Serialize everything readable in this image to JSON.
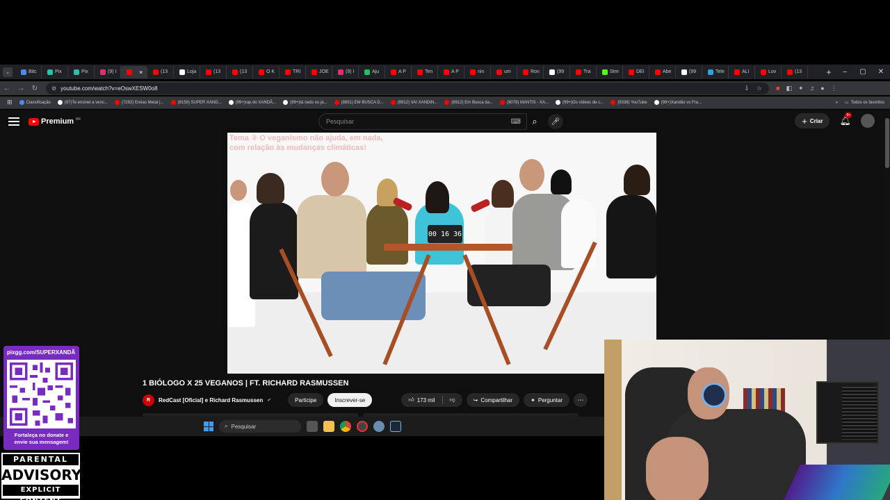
{
  "browser": {
    "tabs": [
      {
        "label": "Bitc",
        "color": "#4c8bf5"
      },
      {
        "label": "Pix",
        "color": "#32bcad"
      },
      {
        "label": "Pix",
        "color": "#32bcad"
      },
      {
        "label": "(9) I",
        "color": "#e1306c"
      },
      {
        "label": "",
        "color": "#ff0000",
        "active": true
      },
      {
        "label": "(13",
        "color": "#ff0000"
      },
      {
        "label": "Loja",
        "color": "#ffffff"
      },
      {
        "label": "(13",
        "color": "#ff0000"
      },
      {
        "label": "(13",
        "color": "#ff0000"
      },
      {
        "label": "O K",
        "color": "#ff0000"
      },
      {
        "label": "TRI",
        "color": "#ff0000"
      },
      {
        "label": "JOE",
        "color": "#ff0000"
      },
      {
        "label": "(9) I",
        "color": "#e1306c"
      },
      {
        "label": "Aju",
        "color": "#20c05c"
      },
      {
        "label": "A P",
        "color": "#ff0000"
      },
      {
        "label": "Ten",
        "color": "#ff0000"
      },
      {
        "label": "A P",
        "color": "#ff0000"
      },
      {
        "label": "nin",
        "color": "#ff0000"
      },
      {
        "label": "um",
        "color": "#ff0000"
      },
      {
        "label": "Ron",
        "color": "#ff0000"
      },
      {
        "label": "(99",
        "color": "#ffffff"
      },
      {
        "label": "Tra",
        "color": "#ff0000"
      },
      {
        "label": "Stre",
        "color": "#53fc18"
      },
      {
        "label": "DEI",
        "color": "#ff0000"
      },
      {
        "label": "Abe",
        "color": "#ff0000"
      },
      {
        "label": "(99",
        "color": "#ffffff"
      },
      {
        "label": "Tele",
        "color": "#2aa3e0"
      },
      {
        "label": "ALI",
        "color": "#ff0000"
      },
      {
        "label": "Lov",
        "color": "#ff0000"
      },
      {
        "label": "(13",
        "color": "#ff0000"
      }
    ],
    "tab_close": "×",
    "new_tab": "+",
    "window_controls": {
      "minimize": "–",
      "maximize": "▢",
      "close": "✕"
    },
    "url": "youtube.com/watch?v=eOswXESW0o8",
    "bookmarks": [
      {
        "label": "Classificação",
        "color": "#4c8bf5"
      },
      {
        "label": "(97)Te ensinei a venc...",
        "color": "#ffffff"
      },
      {
        "label": "(7292) Enéas Metal |...",
        "color": "#ff0000"
      },
      {
        "label": "(8159) SUPER XAND...",
        "color": "#ff0000"
      },
      {
        "label": "(99+)rap do XANDÃ...",
        "color": "#ffffff"
      },
      {
        "label": "(99+)tá cedo ou já...",
        "color": "#ffffff"
      },
      {
        "label": "(8851) EM BUSCA D...",
        "color": "#ff0000"
      },
      {
        "label": "(8912) VAI XANDIN...",
        "color": "#ff0000"
      },
      {
        "label": "(8912) Em Busca da...",
        "color": "#ff0000"
      },
      {
        "label": "(9078) MANTIS - XA...",
        "color": "#ff0000"
      },
      {
        "label": "(99+)Os vídeos de c...",
        "color": "#ffffff"
      },
      {
        "label": "(9338) YouTube",
        "color": "#ff0000"
      },
      {
        "label": "(99+)Xandão vs Fra...",
        "color": "#ffffff"
      }
    ],
    "bookmarks_more": "»",
    "all_bookmarks": "Todos os favoritos"
  },
  "youtube": {
    "logo_text": "Premium",
    "logo_region": "BR",
    "search_placeholder": "Pesquisar",
    "create_label": "Criar",
    "notif_badge": "9+",
    "video": {
      "caption_line1": "Tema ② O veganismo não ajuda, em nada,",
      "caption_line2": "com relação às mudanças climáticas!",
      "timer": "00 16 36"
    },
    "title": "1 BIÓLOGO X 25 VEGANOS | FT. RICHARD RASMUSSEN",
    "channel_initial": "R",
    "channel": "RedCast [Oficial] e Richard Rasmussen",
    "verified": "✔",
    "join_label": "Participe",
    "subscribe_label": "Inscrever-se",
    "likes": "173 mil",
    "share_label": "Compartilhar",
    "ask_label": "Perguntar",
    "more_label": "⋯"
  },
  "taskbar": {
    "search_placeholder": "Pesquisar"
  },
  "overlay": {
    "donate_url": "pixgg.com/SUPERXANDÃ",
    "donate_message_1": "Fortaleça no donate e",
    "donate_message_2": "envie sua mensagem!",
    "advisory_top": "PARENTAL",
    "advisory_mid": "ADVISORY",
    "advisory_bot": "EXPLICIT CONTENT"
  }
}
